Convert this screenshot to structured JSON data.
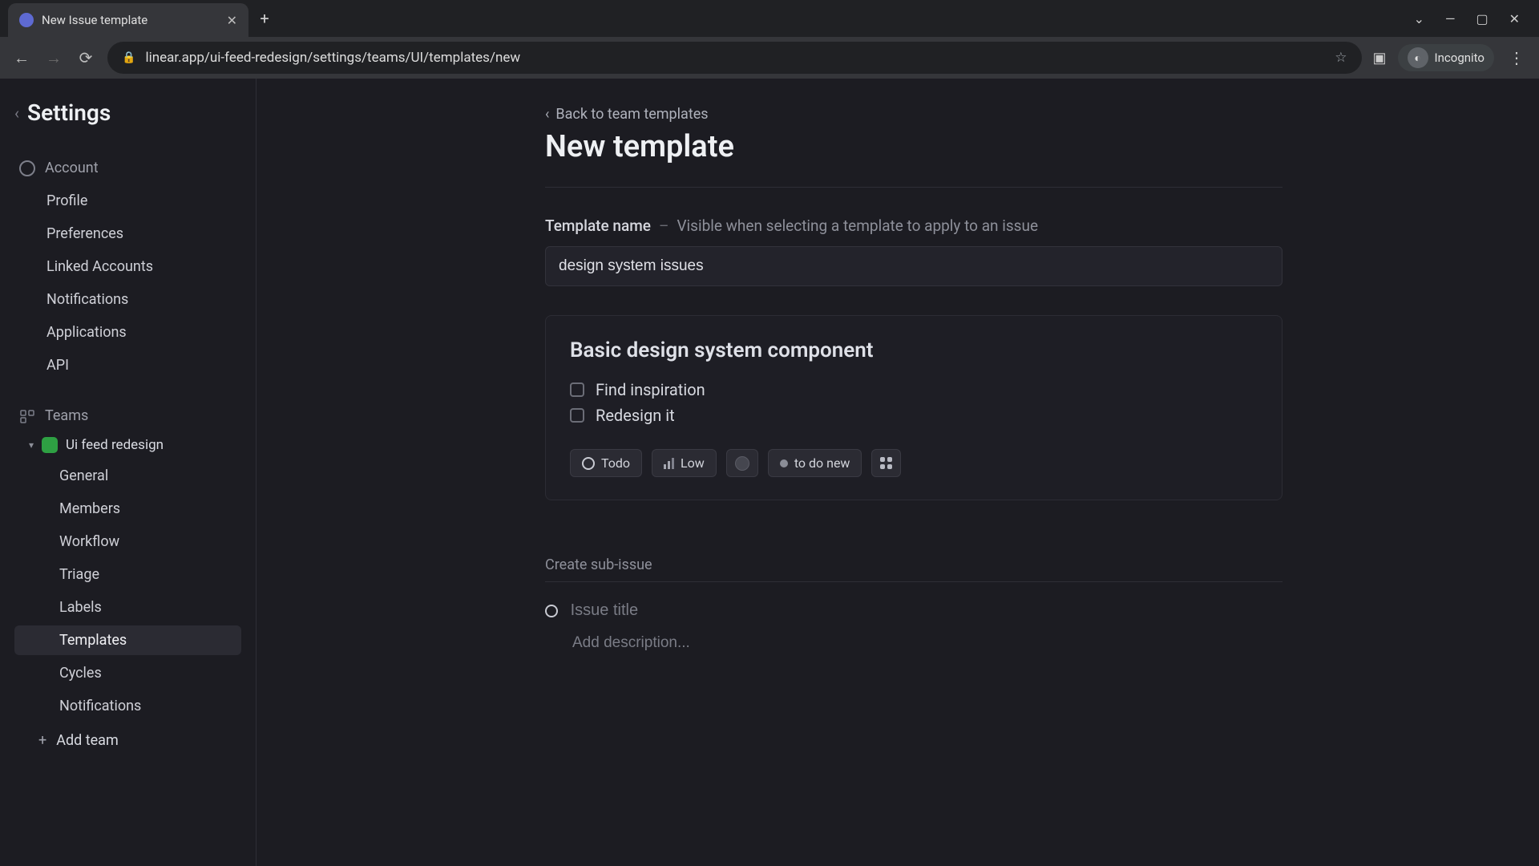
{
  "browser": {
    "tab_title": "New Issue template",
    "url": "linear.app/ui-feed-redesign/settings/teams/UI/templates/new",
    "incognito_label": "Incognito"
  },
  "sidebar": {
    "title": "Settings",
    "account_label": "Account",
    "account_items": [
      "Profile",
      "Preferences",
      "Linked Accounts",
      "Notifications",
      "Applications",
      "API"
    ],
    "teams_label": "Teams",
    "team_name": "Ui feed redesign",
    "team_items": [
      "General",
      "Members",
      "Workflow",
      "Triage",
      "Labels",
      "Templates",
      "Cycles",
      "Notifications"
    ],
    "active_team_item": "Templates",
    "add_team_label": "Add team"
  },
  "main": {
    "back_link": "Back to team templates",
    "page_title": "New template",
    "template_name_label": "Template name",
    "template_name_hint": "Visible when selecting a template to apply to an issue",
    "template_name_value": "design system issues",
    "card": {
      "title": "Basic design system component",
      "checklist": [
        "Find inspiration",
        "Redesign it"
      ],
      "pills": {
        "status": "Todo",
        "priority": "Low",
        "label": "to do new"
      }
    },
    "subissue": {
      "section_label": "Create sub-issue",
      "title_placeholder": "Issue title",
      "desc_placeholder": "Add description..."
    }
  }
}
